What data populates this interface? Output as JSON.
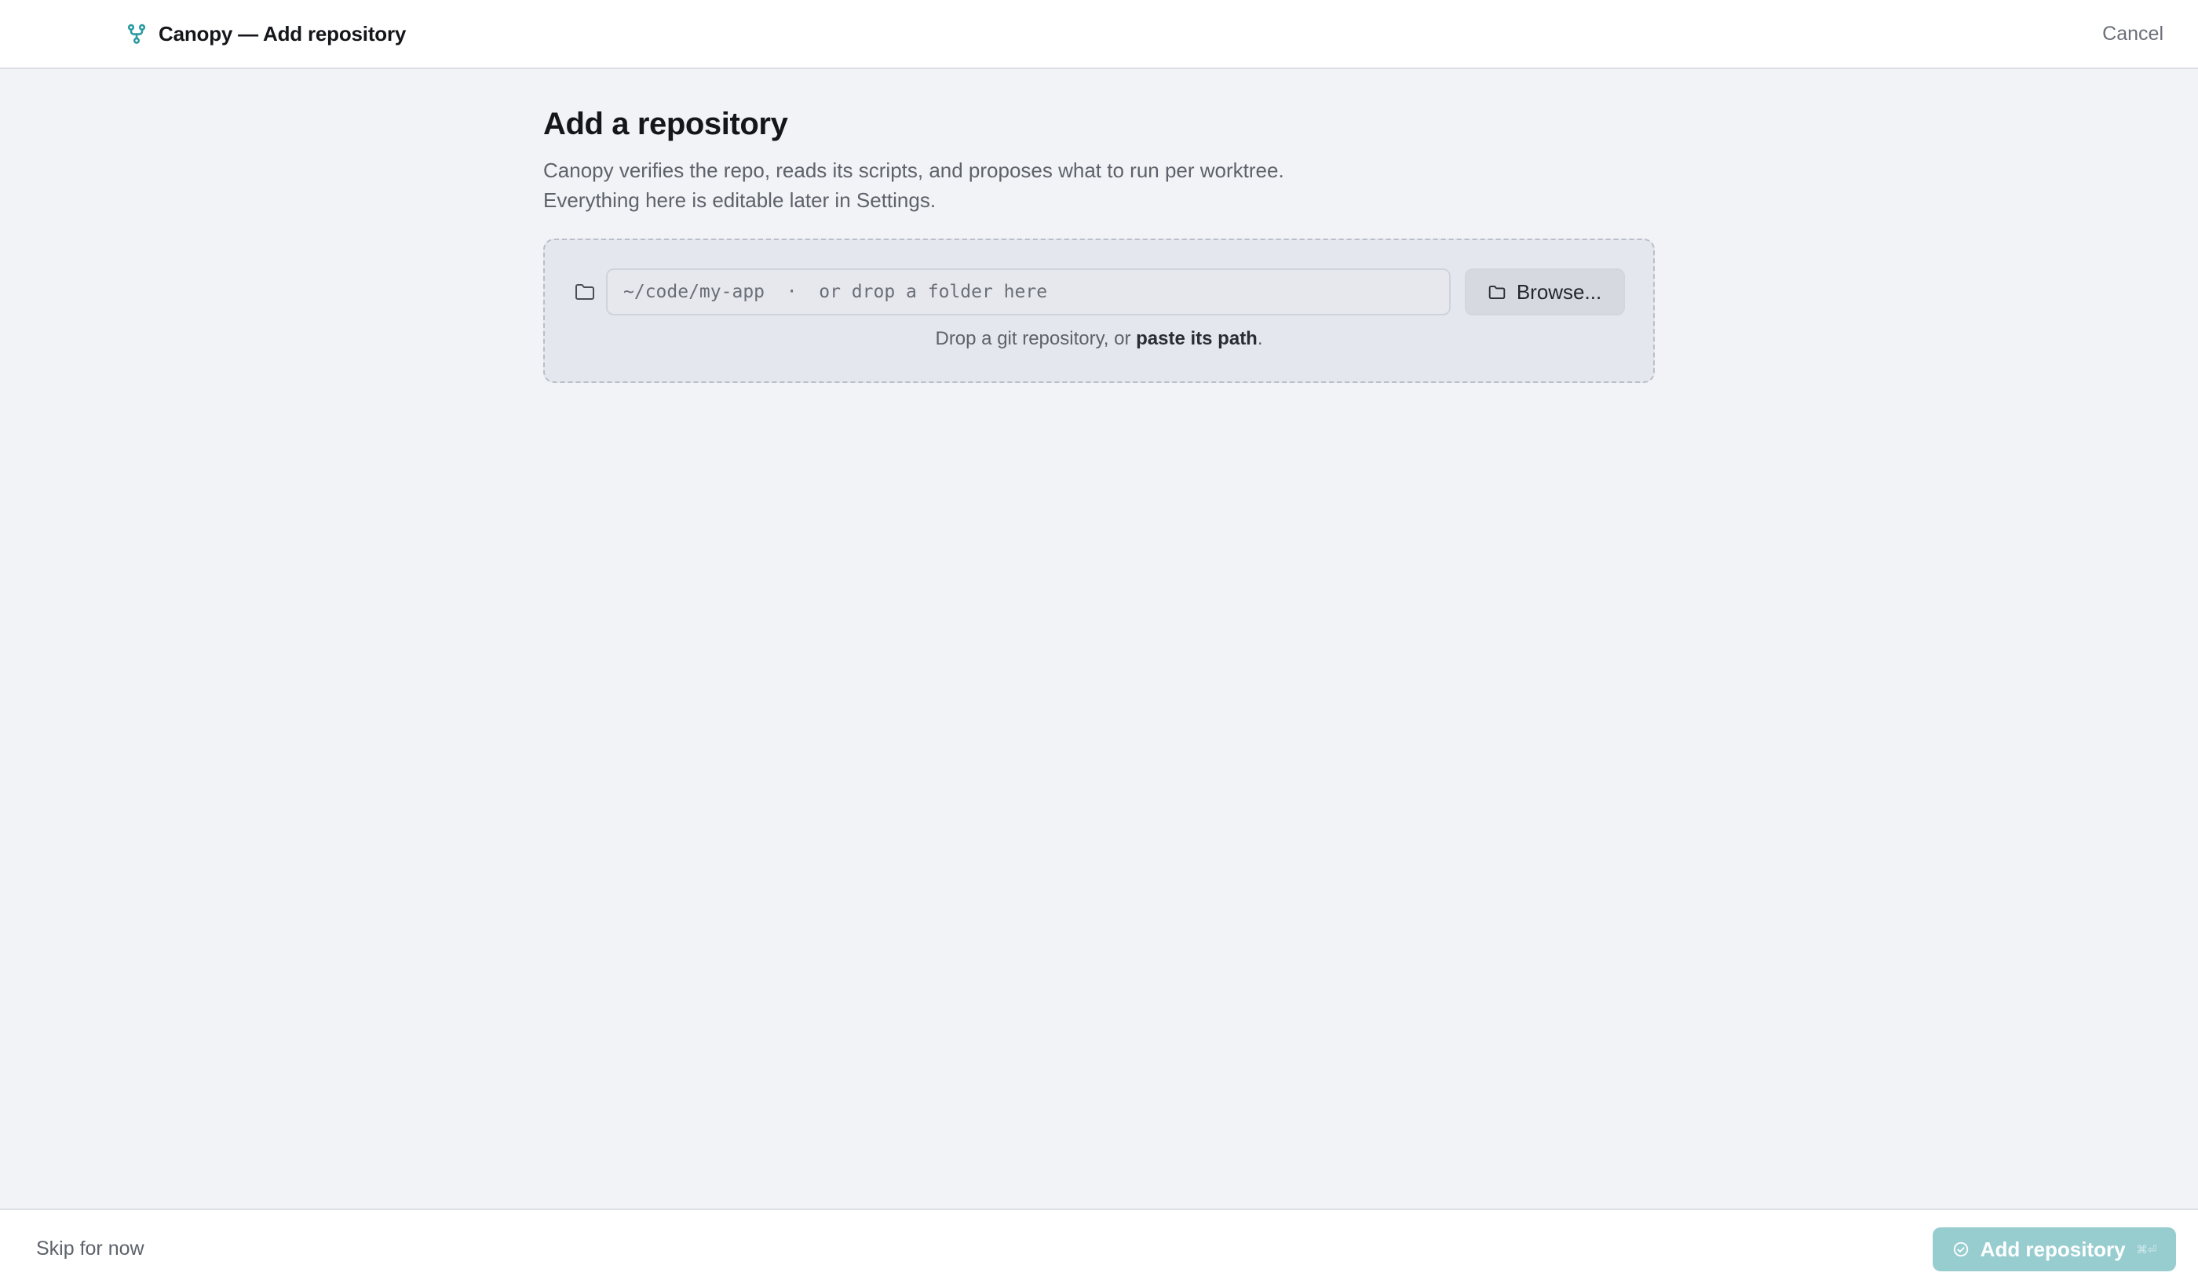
{
  "header": {
    "title": "Canopy — Add repository",
    "cancel_label": "Cancel",
    "brand_icon": "git-branch-icon",
    "accent_color": "#2a9aa0"
  },
  "main": {
    "title": "Add a repository",
    "description_line1": "Canopy verifies the repo, reads its scripts, and proposes what to run per worktree.",
    "description_line2": "Everything here is editable later in Settings.",
    "path_input": {
      "value": "",
      "placeholder": "~/code/my-app  ·  or drop a folder here"
    },
    "browse_label": "Browse...",
    "hint_prefix": "Drop a git repository, or ",
    "hint_emphasis": "paste its path",
    "hint_suffix": "."
  },
  "footer": {
    "skip_label": "Skip for now",
    "add_label": "Add repository",
    "add_shortcut": "⌘⏎",
    "add_button_color": "#98cdd0"
  }
}
